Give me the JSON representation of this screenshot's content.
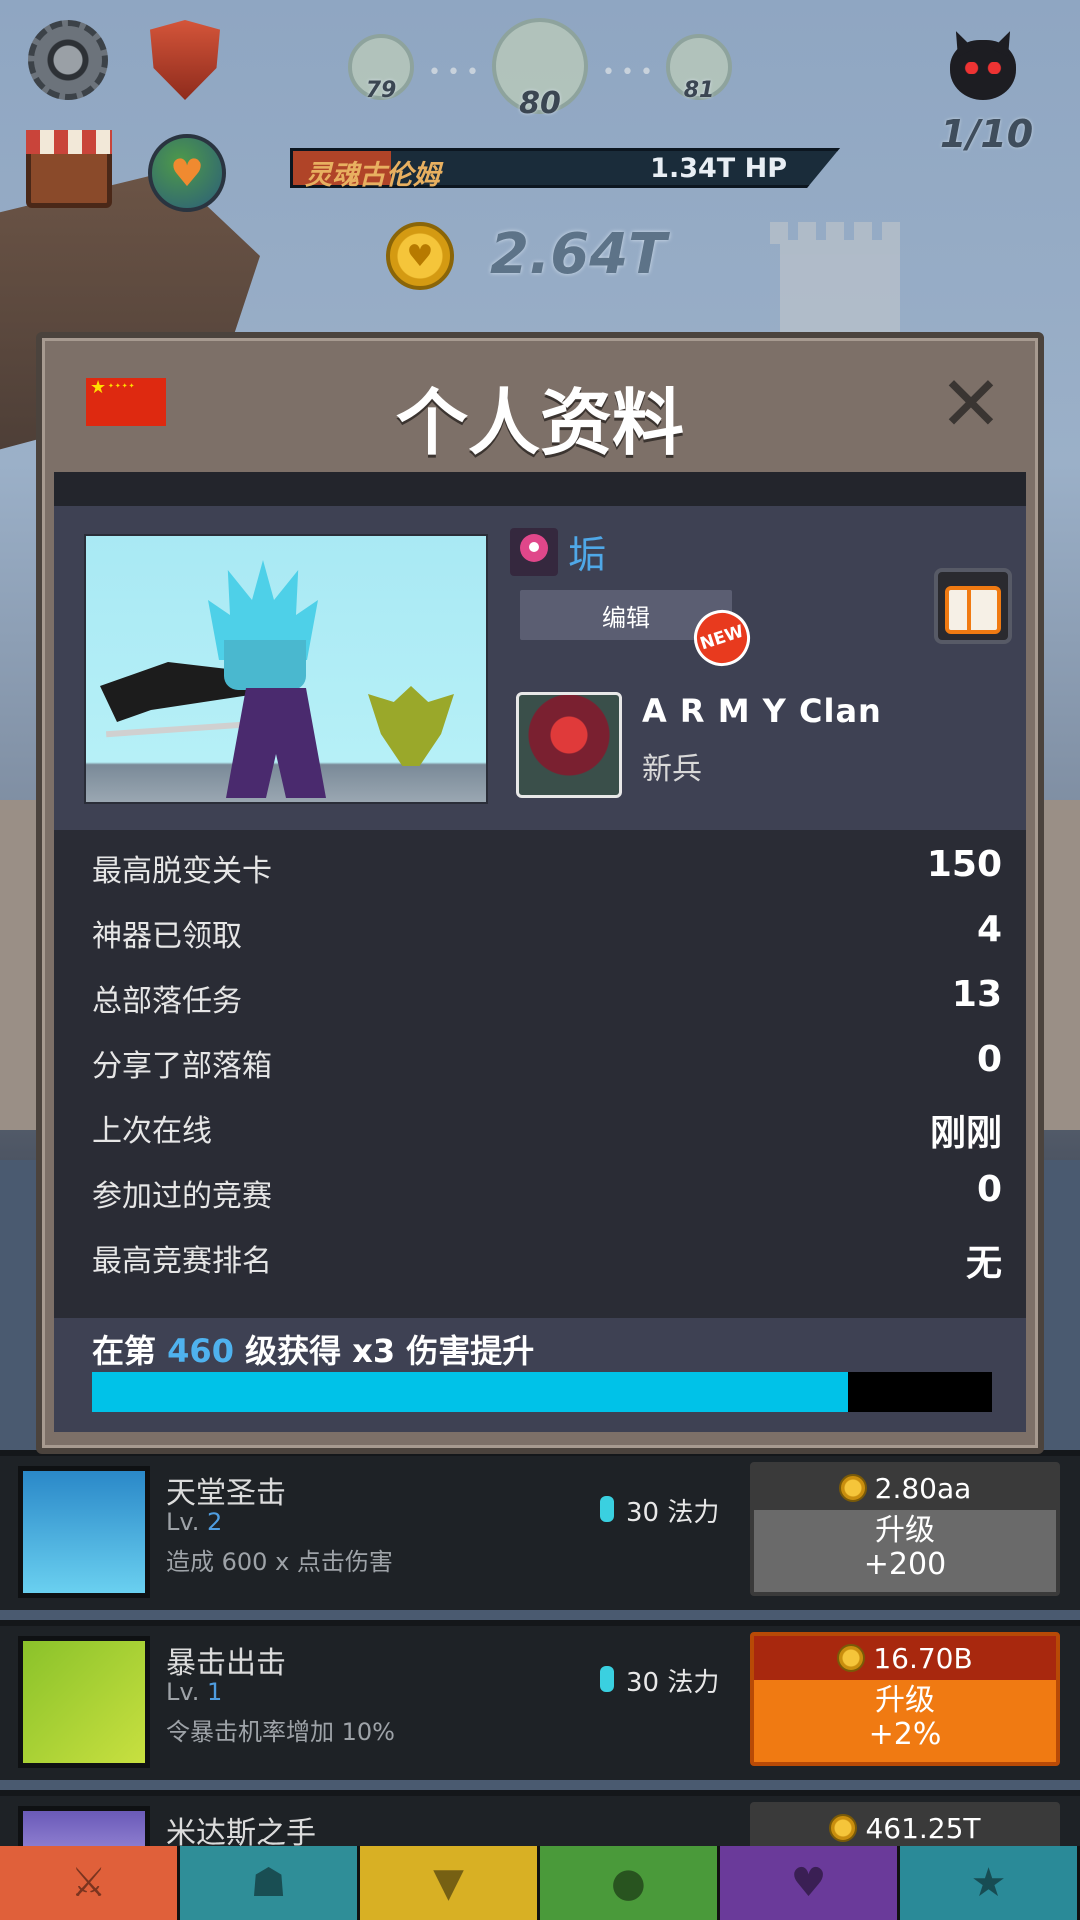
{
  "hud": {
    "stages": [
      "79",
      "80",
      "81"
    ],
    "boss_name": "灵魂古伦姆",
    "boss_hp": "1.34T HP",
    "kills": "1/10",
    "gold": "2.64T"
  },
  "profile": {
    "title": "个人资料",
    "player_name": "垢",
    "edit_label": "编辑",
    "new_badge": "NEW",
    "clan_name": "A R M Y Clan",
    "clan_rank": "新兵",
    "stats": [
      {
        "label": "最高脱变关卡",
        "value": "150"
      },
      {
        "label": "神器已领取",
        "value": "4"
      },
      {
        "label": "总部落任务",
        "value": "13"
      },
      {
        "label": "分享了部落箱",
        "value": "0"
      },
      {
        "label": "上次在线",
        "value": "刚刚"
      },
      {
        "label": "参加过的竞赛",
        "value": "0"
      },
      {
        "label": "最高竞赛排名",
        "value": "无"
      }
    ],
    "bonus": {
      "prefix": "在第",
      "level": "460",
      "suffix": "级获得 x3 伤害提升",
      "progress": 0.84
    }
  },
  "skills": [
    {
      "name": "天堂圣击",
      "lv_prefix": "Lv.",
      "lv": "2",
      "desc": "造成 600 x 点击伤害",
      "mana": "30 法力",
      "cost": "2.80aa",
      "upgrade": "升级",
      "bonus": "+200",
      "style": "gray"
    },
    {
      "name": "暴击出击",
      "lv_prefix": "Lv.",
      "lv": "1",
      "desc": "令暴击机率增加 10%",
      "mana": "30 法力",
      "cost": "16.70B",
      "upgrade": "升级",
      "bonus": "+2%",
      "style": "orange"
    },
    {
      "name": "米达斯之手",
      "cost": "461.25T"
    }
  ],
  "colors": {
    "accent": "#00c2e8",
    "name_blue": "#4fa8e8",
    "upgrade_orange": "#f07a12",
    "upgrade_gray": "#6a6a6a"
  }
}
